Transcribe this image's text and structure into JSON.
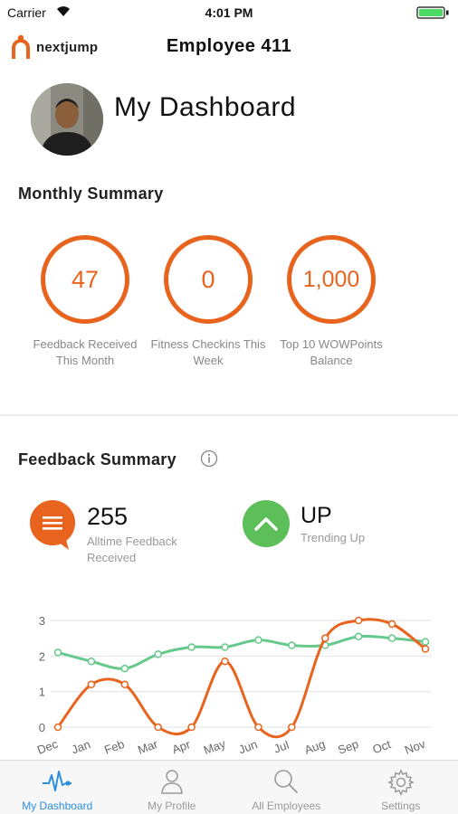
{
  "status_bar": {
    "carrier": "Carrier",
    "time": "4:01 PM"
  },
  "header": {
    "logo_text": "nextjump",
    "title": "Employee 411"
  },
  "dashboard": {
    "title": "My Dashboard"
  },
  "monthly_summary": {
    "title": "Monthly Summary",
    "stats": [
      {
        "value": "47",
        "label": "Feedback Received This Month"
      },
      {
        "value": "0",
        "label": "Fitness Checkins This Week"
      },
      {
        "value": "1,000",
        "label": "Top 10 WOWPoints Balance"
      }
    ]
  },
  "feedback_summary": {
    "title": "Feedback Summary",
    "alltime": {
      "value": "255",
      "label": "Alltime Feedback Received"
    },
    "trend": {
      "value": "UP",
      "label": "Trending Up"
    }
  },
  "chart_data": {
    "type": "line",
    "x": [
      "Dec",
      "Jan",
      "Feb",
      "Mar",
      "Apr",
      "May",
      "Jun",
      "Jul",
      "Aug",
      "Sep",
      "Oct",
      "Nov"
    ],
    "yticks": [
      "0",
      "1",
      "2",
      "3"
    ],
    "ylim": [
      0,
      3
    ],
    "series": [
      {
        "color": "#64c98a",
        "values": [
          2.1,
          1.85,
          1.65,
          2.05,
          2.25,
          2.25,
          2.45,
          2.3,
          2.3,
          2.55,
          2.5,
          2.4
        ]
      },
      {
        "color": "#e8641e",
        "values": [
          0,
          1.2,
          1.2,
          0,
          0,
          1.85,
          0,
          0,
          2.5,
          3.0,
          2.9,
          2.2
        ]
      }
    ],
    "grid": true
  },
  "tabs": [
    {
      "label": "My Dashboard",
      "icon": "pulse-icon",
      "active": true
    },
    {
      "label": "My Profile",
      "icon": "person-icon",
      "active": false
    },
    {
      "label": "All Employees",
      "icon": "search-icon",
      "active": false
    },
    {
      "label": "Settings",
      "icon": "gear-icon",
      "active": false
    }
  ],
  "colors": {
    "accent": "#e8641e",
    "green": "#5cbf5a",
    "tab_active": "#2b8fe0"
  }
}
